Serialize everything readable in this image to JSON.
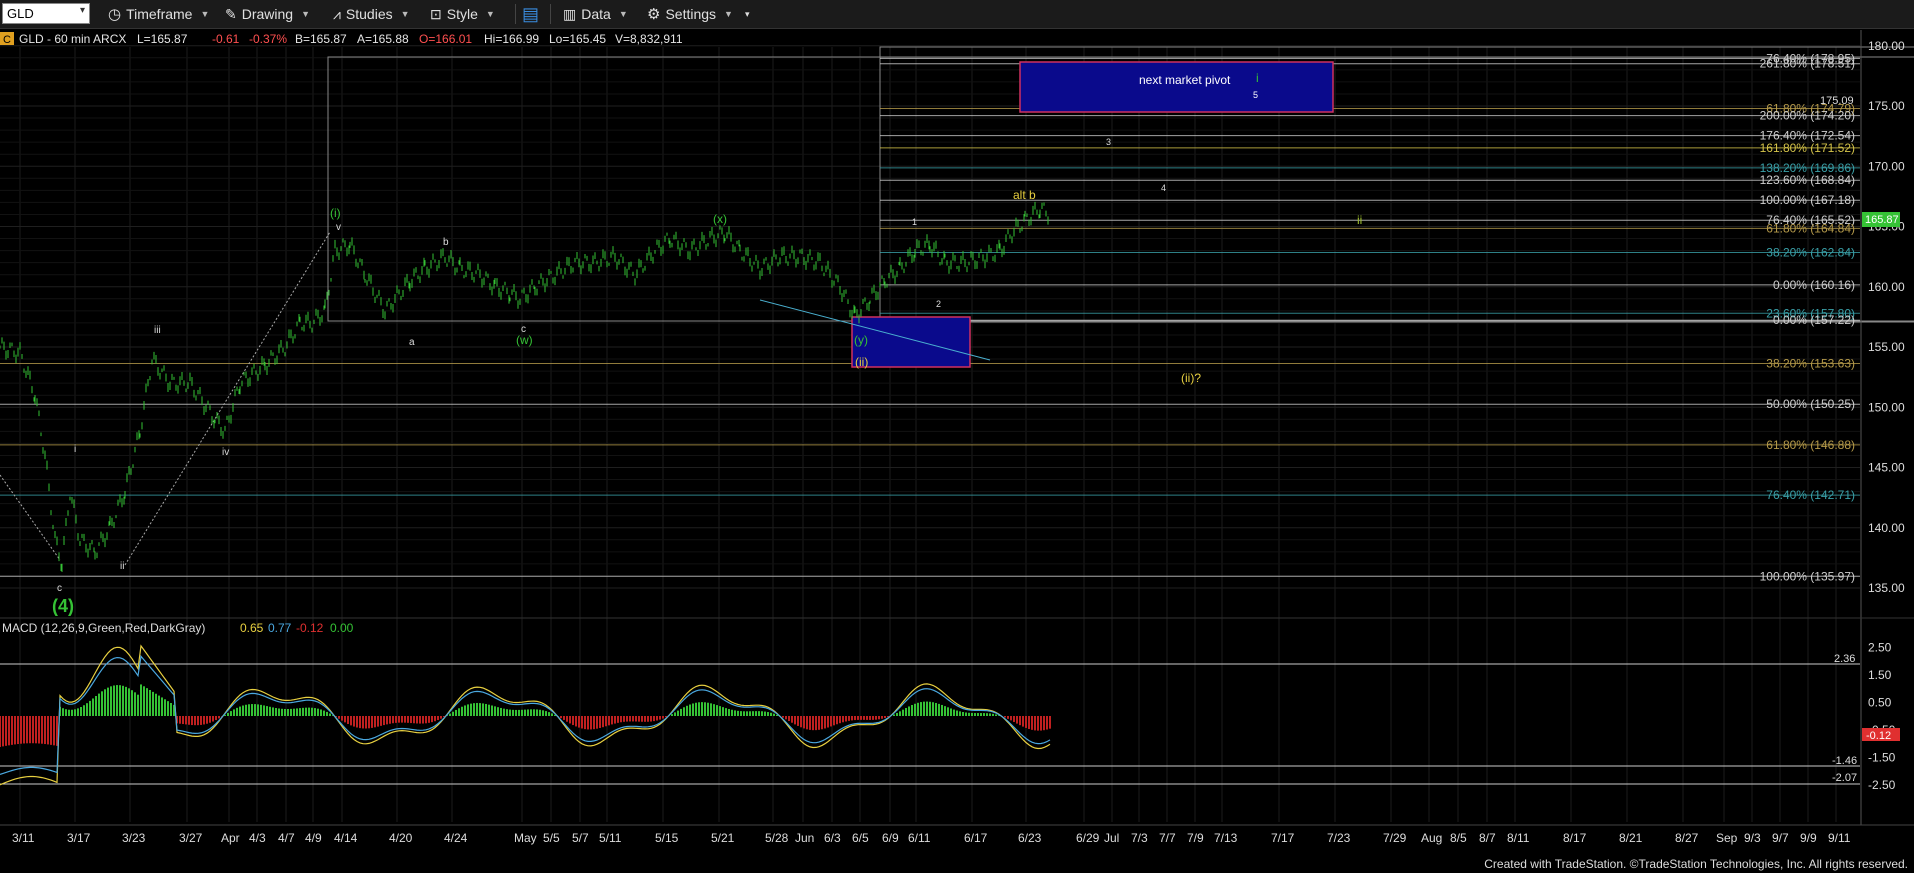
{
  "toolbar": {
    "symbol": "GLD",
    "timeframe": "Timeframe",
    "drawing": "Drawing",
    "studies": "Studies",
    "style": "Style",
    "data": "Data",
    "settings": "Settings"
  },
  "header": {
    "c_badge": "C",
    "symbol_desc": "GLD - 60 min  ARCX",
    "last": "L=165.87",
    "change": "-0.61",
    "pct": "-0.37%",
    "bid": "B=165.87",
    "ask": "A=165.88",
    "open": "O=166.01",
    "high": "Hi=166.99",
    "low": "Lo=165.45",
    "volume": "V=8,832,911"
  },
  "price_axis": {
    "labels": [
      "180.00",
      "175.00",
      "170.00",
      "165.00",
      "160.00",
      "155.00",
      "150.00",
      "145.00",
      "140.00",
      "135.00"
    ],
    "last_tag": "165.87",
    "extra": "175.09"
  },
  "macd": {
    "label": "MACD (12,26,9,Green,Red,DarkGray)",
    "v1": "0.65",
    "v2": "0.77",
    "v3": "-0.12",
    "v4": "0.00",
    "axis": [
      "2.50",
      "1.50",
      "0.50",
      "-0.50",
      "-1.50",
      "-2.50"
    ],
    "levels": [
      "2.36",
      "-1.46",
      "-2.07"
    ],
    "tag": "-0.12"
  },
  "fib_labels": [
    {
      "text": "76.40% (178.95)",
      "color": "#cfcfcf"
    },
    {
      "text": "261.80% (178.51)",
      "color": "#cfcfcf"
    },
    {
      "text": "61.80% (174.79)",
      "color": "#b59a4a"
    },
    {
      "text": "200.00% (174.20)",
      "color": "#cfcfcf"
    },
    {
      "text": "176.40% (172.54)",
      "color": "#cfcfcf"
    },
    {
      "text": "161.80% (171.52)",
      "color": "#d4c34a"
    },
    {
      "text": "138.20% (169.86)",
      "color": "#3aa0a8"
    },
    {
      "text": "123.60% (168.84)",
      "color": "#cfcfcf"
    },
    {
      "text": "100.00% (167.18)",
      "color": "#cfcfcf"
    },
    {
      "text": "76.40% (165.52)",
      "color": "#cfcfcf"
    },
    {
      "text": "61.80% (164.84)",
      "color": "#b59a4a"
    },
    {
      "text": "38.20% (162.84)",
      "color": "#3aa0a8"
    },
    {
      "text": "0.00% (160.16)",
      "color": "#cfcfcf"
    },
    {
      "text": "23.60% (157.80)",
      "color": "#3aa0a8"
    },
    {
      "text": "0.00% (157.22)",
      "color": "#cfcfcf"
    },
    {
      "text": "38.20% (153.63)",
      "color": "#b59a4a"
    },
    {
      "text": "50.00% (150.25)",
      "color": "#cfcfcf"
    },
    {
      "text": "61.80% (146.88)",
      "color": "#b59a4a"
    },
    {
      "text": "76.40% (142.71)",
      "color": "#3aa0a8"
    },
    {
      "text": "100.00% (135.97)",
      "color": "#cfcfcf"
    }
  ],
  "annotations": {
    "pivot": "next market pivot",
    "pivot_i": "i",
    "pivot_5": "5",
    "w3": "3",
    "w4": "4",
    "alt_b": "alt b",
    "w1": "1",
    "w2": "2",
    "ii_right": "ii",
    "ii_q": "(ii)?",
    "paren_i": "(i)",
    "v": "v",
    "x": "(x)",
    "y": "(y)",
    "paren_ii": "(ii)",
    "b": "b",
    "a": "a",
    "c_mid": "c",
    "w": "(w)",
    "iii": "iii",
    "iv": "iv",
    "i_small": "i",
    "ii_small": "ii",
    "c_low": "c",
    "four": "(4)"
  },
  "dates": [
    "3/11",
    "3/17",
    "3/23",
    "3/27",
    "Apr",
    "4/3",
    "4/7",
    "4/9",
    "4/14",
    "4/20",
    "4/24",
    "May",
    "5/5",
    "5/7",
    "5/11",
    "5/15",
    "5/21",
    "5/28",
    "Jun",
    "6/3",
    "6/5",
    "6/9",
    "6/11",
    "6/17",
    "6/23",
    "6/29",
    "Jul",
    "7/3",
    "7/7",
    "7/9",
    "7/13",
    "7/17",
    "7/23",
    "7/29",
    "Aug",
    "8/5",
    "8/7",
    "8/11",
    "8/17",
    "8/21",
    "8/27",
    "Sep",
    "9/3",
    "9/7",
    "9/9",
    "9/11"
  ],
  "footer": "Created with TradeStation. ©TradeStation Technologies, Inc. All rights reserved.",
  "colors": {
    "up": "#35c235",
    "down": "#e03030",
    "signal": "#e8d040",
    "macd_line": "#4aa8e0",
    "pivot_box": "#0a0a8c"
  }
}
